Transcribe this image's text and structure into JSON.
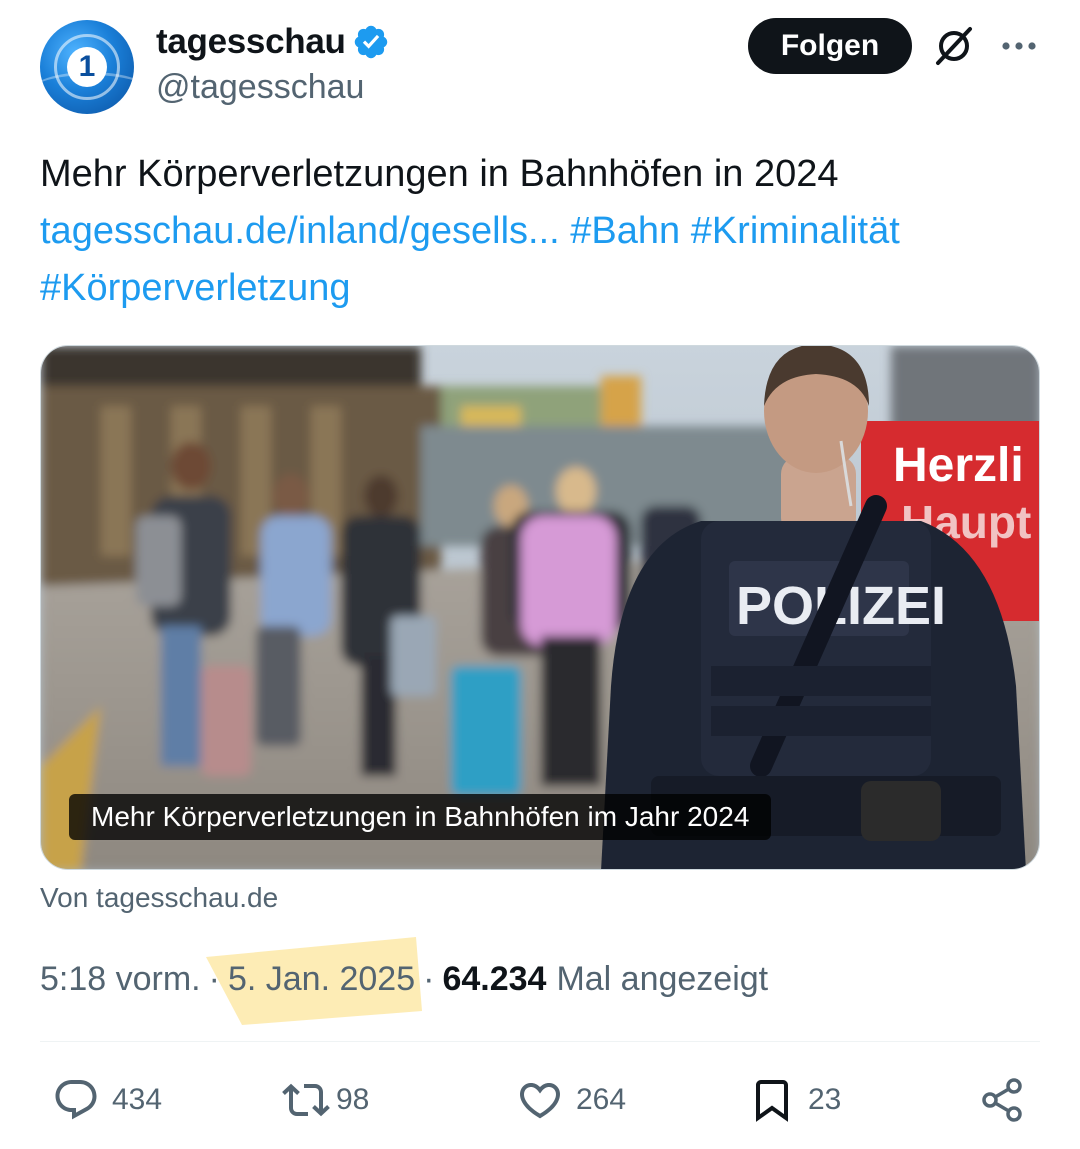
{
  "account": {
    "display_name": "tagesschau",
    "handle": "@tagesschau",
    "avatar_glyph": "1",
    "verified": true
  },
  "header": {
    "follow_label": "Folgen"
  },
  "tweet": {
    "text": "Mehr Körperverletzungen in Bahnhöfen in 2024",
    "link": "tagesschau.de/inland/gesells...",
    "hashtags": [
      "#Bahn",
      "#Kriminalität",
      "#Körperverletzung"
    ]
  },
  "media": {
    "caption": "Mehr Körperverletzungen in Bahnhöfen im Jahr 2024",
    "vest_text": "POLIZEI",
    "sign_text": [
      "Herzli",
      "Haupt"
    ],
    "source": "Von tagesschau.de"
  },
  "meta": {
    "time": "5:18 vorm.",
    "date": "5. Jan. 2025",
    "views_count": "64.234",
    "views_label": "Mal angezeigt",
    "separator": "·"
  },
  "actions": {
    "replies": "434",
    "reposts": "98",
    "likes": "264",
    "bookmarks": "23"
  },
  "colors": {
    "link": "#1d9bf0",
    "secondary_text": "#536471",
    "primary_text": "#0f1419",
    "highlight": "#fde9a8",
    "verified": "#1d9bf0"
  },
  "icons": [
    "verified-badge-icon",
    "grok-icon",
    "more-icon",
    "reply-icon",
    "repost-icon",
    "like-icon",
    "bookmark-icon",
    "share-icon"
  ]
}
